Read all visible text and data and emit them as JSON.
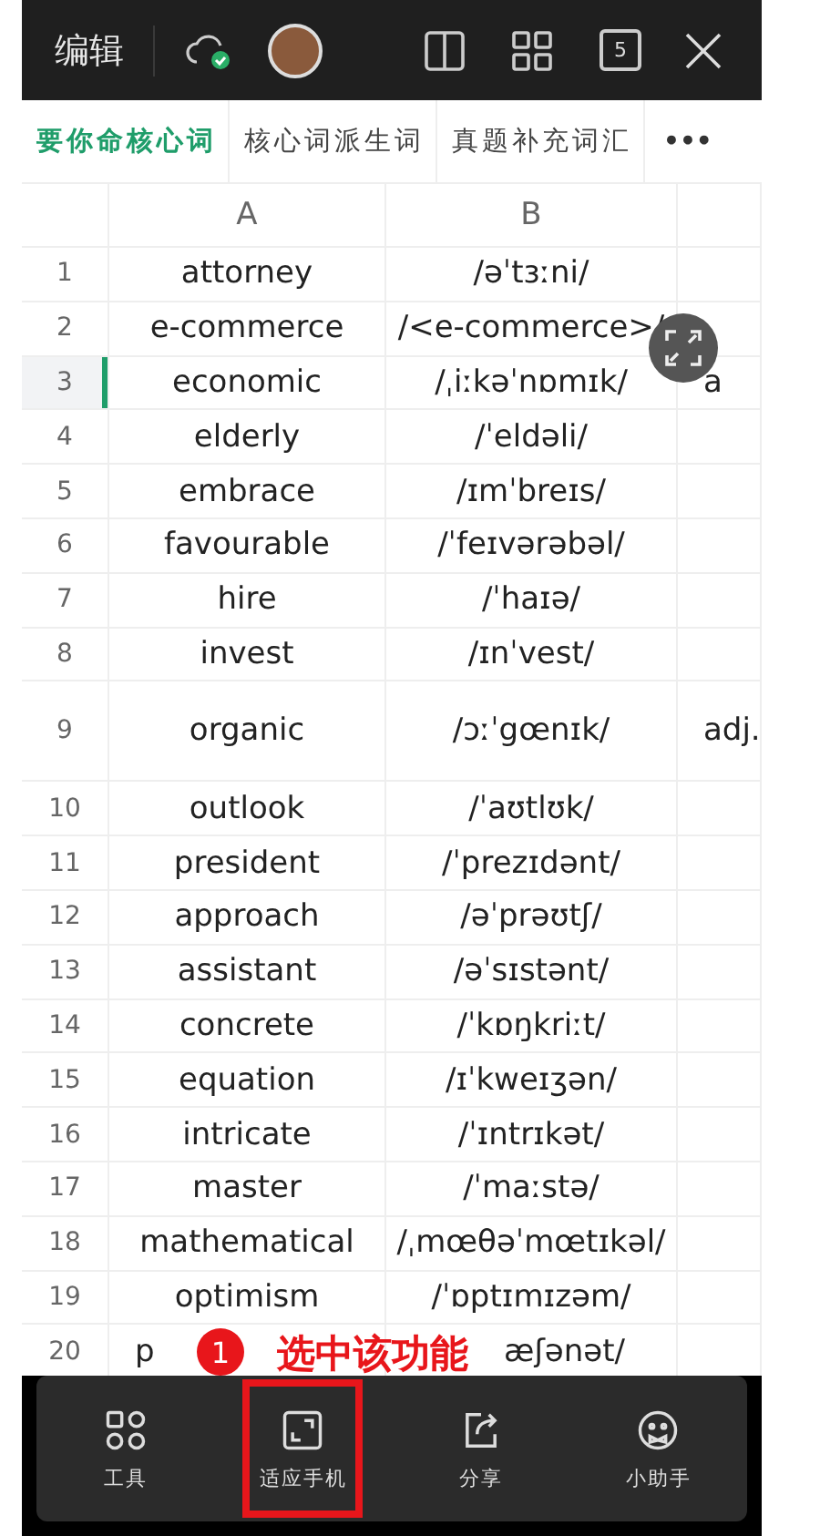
{
  "top_bar": {
    "title": "编辑",
    "page_count": "5"
  },
  "sheet_tabs": [
    {
      "label": "要你命核心词",
      "selected": true
    },
    {
      "label": "核心词派生词",
      "selected": false
    },
    {
      "label": "真题补充词汇",
      "selected": false
    }
  ],
  "more_tabs": "•••",
  "columns": [
    "A",
    "B"
  ],
  "rows": [
    {
      "number": "1",
      "word": "attorney",
      "phonetic": "/əˈtɜːni/",
      "selected": false
    },
    {
      "number": "2",
      "word": "e-commerce",
      "phonetic": "/<e-commerce>/",
      "selected": false
    },
    {
      "number": "3",
      "word": "economic",
      "phonetic": "/ˌiːkəˈnɒmɪk/",
      "column_3": "a",
      "selected": true
    },
    {
      "number": "4",
      "word": "elderly",
      "phonetic": "/ˈeldəli/",
      "selected": false
    },
    {
      "number": "5",
      "word": "embrace",
      "phonetic": "/ɪmˈbreɪs/",
      "selected": false
    },
    {
      "number": "6",
      "word": "favourable",
      "phonetic": "/ˈfeɪvərəbəl/",
      "selected": false
    },
    {
      "number": "7",
      "word": "hire",
      "phonetic": "/ˈhaɪə/",
      "selected": false
    },
    {
      "number": "8",
      "word": "invest",
      "phonetic": "/ɪnˈvest/",
      "selected": false
    },
    {
      "number": "9",
      "word": "organic",
      "phonetic": "/ɔːˈgœnɪk/",
      "column_3": "adj.",
      "selected": false,
      "tall": true
    },
    {
      "number": "10",
      "word": "outlook",
      "phonetic": "/ˈaʊtlʊk/",
      "selected": false
    },
    {
      "number": "11",
      "word": "president",
      "phonetic": "/ˈprezɪdənt/",
      "selected": false
    },
    {
      "number": "12",
      "word": "approach",
      "phonetic": "/əˈprəʊtʃ/",
      "selected": false
    },
    {
      "number": "13",
      "word": "assistant",
      "phonetic": "/əˈsɪstənt/",
      "selected": false
    },
    {
      "number": "14",
      "word": "concrete",
      "phonetic": "/ˈkɒŋkriːt/",
      "selected": false
    },
    {
      "number": "15",
      "word": "equation",
      "phonetic": "/ɪˈkweɪʒən/",
      "selected": false
    },
    {
      "number": "16",
      "word": "intricate",
      "phonetic": "/ˈɪntrɪkət/",
      "selected": false
    },
    {
      "number": "17",
      "word": "master",
      "phonetic": "/ˈmaːstə/",
      "selected": false
    },
    {
      "number": "18",
      "word": "mathematical",
      "phonetic": "/ˌmœθəˈmœtɪkəl/",
      "selected": false
    },
    {
      "number": "19",
      "word": "optimism",
      "phonetic": "/ˈɒptɪmɪzəm/",
      "selected": false
    },
    {
      "number": "20",
      "word": "p",
      "phonetic": "æʃənət/",
      "selected": false,
      "kind": "covered"
    }
  ],
  "toolbar": [
    {
      "kind": "tools",
      "label": "工具",
      "highlighted": false
    },
    {
      "kind": "fit",
      "label": "适应手机",
      "highlighted": true
    },
    {
      "kind": "share",
      "label": "分享",
      "highlighted": false
    },
    {
      "kind": "assistant",
      "label": "小助手",
      "highlighted": false
    }
  ],
  "annotation": {
    "number": "1",
    "text": "选中该功能"
  }
}
